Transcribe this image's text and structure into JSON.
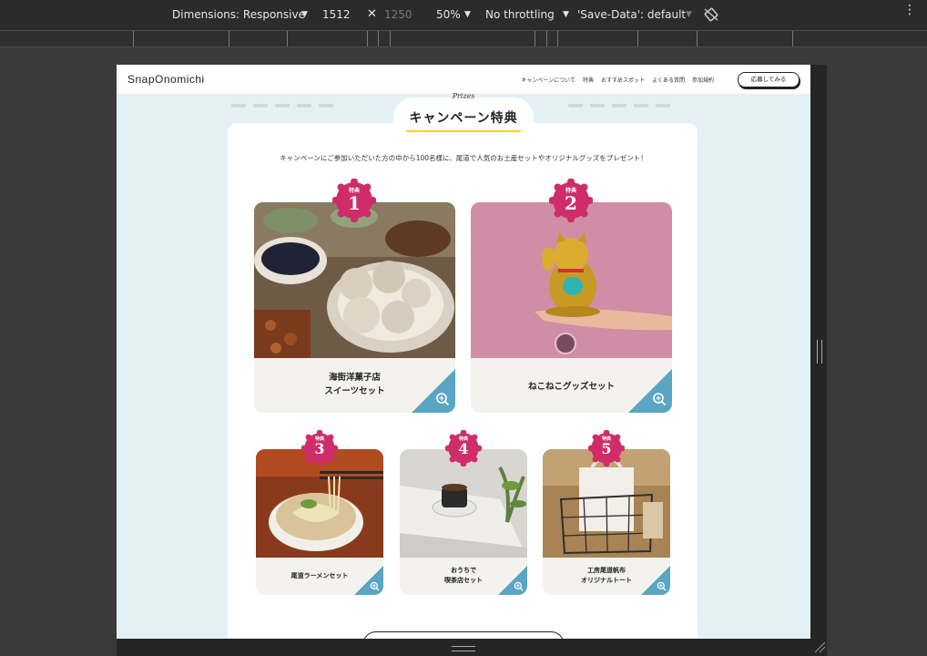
{
  "devtools": {
    "dimensions_label": "Dimensions: Responsive",
    "width": "1512",
    "height": "1250",
    "zoom": "50%",
    "throttling": "No throttling",
    "save_data": "'Save-Data': default"
  },
  "site": {
    "logo": "SnapOnomichi",
    "nav": [
      "キャンペーンについて",
      "特典",
      "おすすめスポット",
      "よくある質問",
      "参加規約"
    ],
    "apply_label": "応募してみる"
  },
  "prizes": {
    "heading_en": "Prizes",
    "heading": "キャンペーン特典",
    "intro": "キャンペーンにご参加いただいた方の中から100名様に、尾道で人気のお土産セットやオリジナルグッズをプレゼント！",
    "badge_label": "特典",
    "items": [
      {
        "number": "1",
        "title": "海街洋菓子店\nスイーツセット"
      },
      {
        "number": "2",
        "title": "ねこねこグッズセット"
      },
      {
        "number": "3",
        "title": "尾道ラーメンセット"
      },
      {
        "number": "4",
        "title": "おうちで\n喫茶店セット"
      },
      {
        "number": "5",
        "title": "工房尾道帆布\nオリジナルトート"
      }
    ]
  },
  "colors": {
    "accent_badge": "#cf2c6a",
    "zoom_tab": "#5aa5c3",
    "page_bg": "#e4f1f4",
    "underline": "#f3d233"
  }
}
